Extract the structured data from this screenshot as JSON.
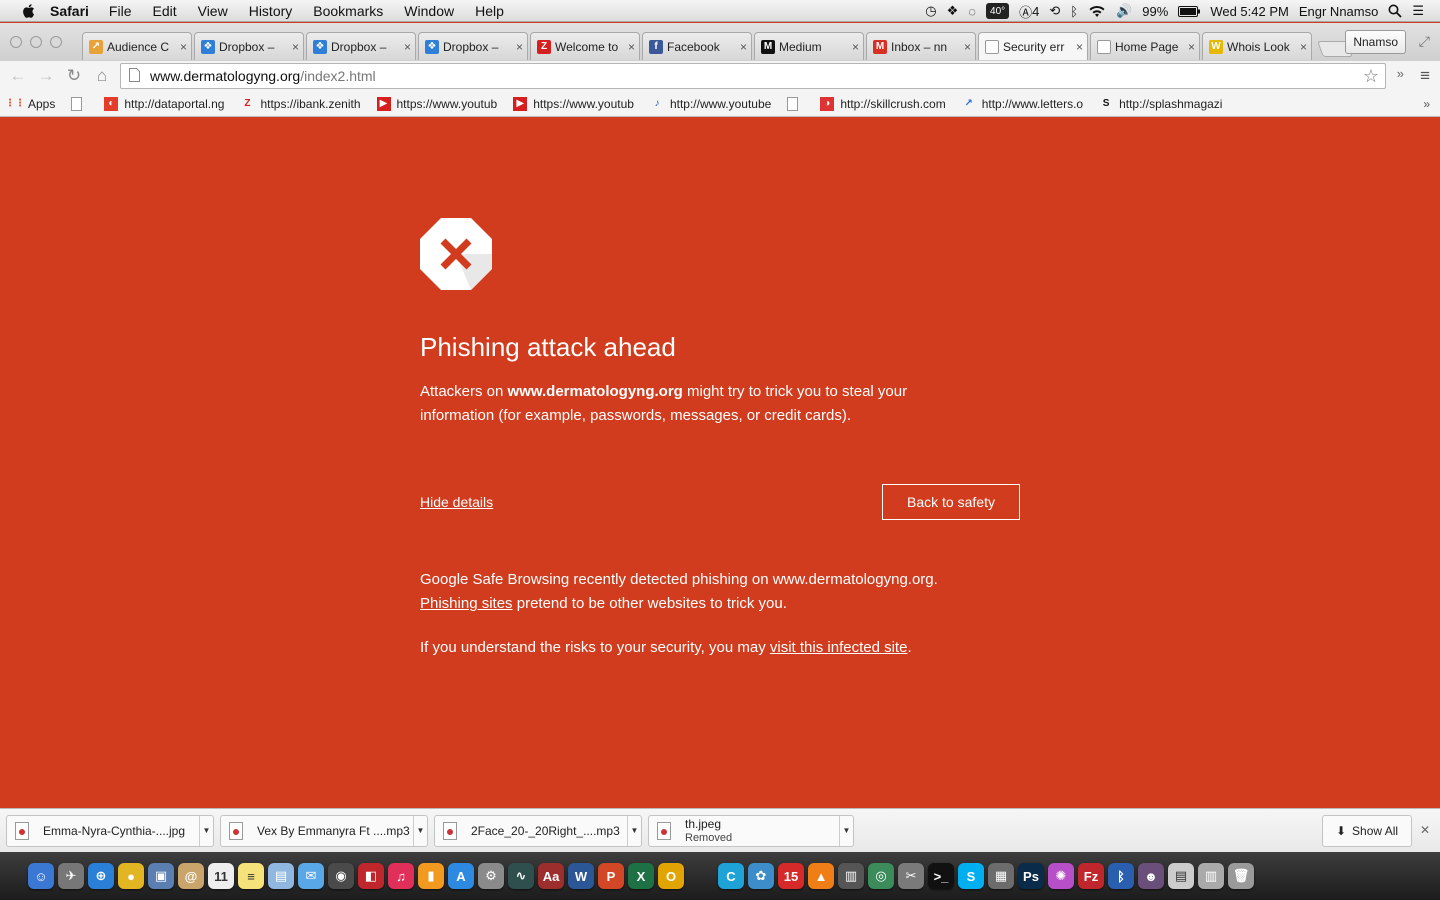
{
  "menubar": {
    "app_name": "Safari",
    "items": [
      "File",
      "Edit",
      "View",
      "History",
      "Bookmarks",
      "Window",
      "Help"
    ],
    "temperature": "40°",
    "adobe_count": "4",
    "battery": "99%",
    "clock": "Wed 5:42 PM",
    "user": "Engr Nnamso"
  },
  "tabs": [
    {
      "title": "Audience C",
      "favicon_color": "#e8a23a",
      "favicon": "chart-icon"
    },
    {
      "title": "Dropbox –",
      "favicon_color": "#2f7ed8",
      "favicon": "dropbox-icon"
    },
    {
      "title": "Dropbox –",
      "favicon_color": "#2f7ed8",
      "favicon": "dropbox-icon"
    },
    {
      "title": "Dropbox –",
      "favicon_color": "#2f7ed8",
      "favicon": "dropbox-icon"
    },
    {
      "title": "Welcome to",
      "favicon_color": "#d6201f",
      "favicon": "zenith-icon"
    },
    {
      "title": "Facebook",
      "favicon_color": "#3b5998",
      "favicon": "facebook-icon"
    },
    {
      "title": "Medium",
      "favicon_color": "#111111",
      "favicon": "medium-icon"
    },
    {
      "title": "Inbox – nn",
      "favicon_color": "#d93025",
      "favicon": "gmail-icon"
    },
    {
      "title": "Security err",
      "favicon_color": "#999999",
      "favicon": "document-icon"
    },
    {
      "title": "Home Page",
      "favicon_color": "#999999",
      "favicon": "document-icon"
    },
    {
      "title": "Whois Look",
      "favicon_color": "#e6b800",
      "favicon": "whois-icon"
    }
  ],
  "profile_button": "Nnamso",
  "address": {
    "host": "www.dermatologyng.org",
    "path": "/index2.html"
  },
  "bookmarks": [
    {
      "label": "Apps",
      "icon": "apps-grid-icon"
    },
    {
      "label": "",
      "icon": "document-icon"
    },
    {
      "label": "http://dataportal.ng",
      "icon": "dataportal-icon"
    },
    {
      "label": "https://ibank.zenith",
      "icon": "zenith-icon"
    },
    {
      "label": "https://www.youtub",
      "icon": "youtube-icon"
    },
    {
      "label": "https://www.youtub",
      "icon": "youtube-icon"
    },
    {
      "label": "http://www.youtube",
      "icon": "mp3-icon"
    },
    {
      "label": "",
      "icon": "document-icon"
    },
    {
      "label": "http://skillcrush.com",
      "icon": "skillcrush-icon"
    },
    {
      "label": "http://www.letters.o",
      "icon": "letters-icon"
    },
    {
      "label": "http://splashmagazi",
      "icon": "splash-icon"
    }
  ],
  "interstitial": {
    "headline": "Phishing attack ahead",
    "lead_prefix": "Attackers on ",
    "lead_domain": "www.dermatologyng.org",
    "lead_suffix": " might try to trick you to steal your information (for example, passwords, messages, or credit cards).",
    "hide_details": "Hide details",
    "back_button": "Back to safety",
    "detail_1": "Google Safe Browsing recently detected phishing on www.dermatologyng.org.",
    "detail_2_link": "Phishing sites",
    "detail_2_rest": " pretend to be other websites to trick you.",
    "detail_3_prefix": "If you understand the risks to your security, you may ",
    "detail_3_link": "visit this infected site",
    "detail_3_suffix": ".",
    "background_color": "#d13c1e"
  },
  "downloads": {
    "items": [
      {
        "name": "Emma-Nyra-Cynthia-....jpg"
      },
      {
        "name": "Vex By Emmanyra Ft ....mp3"
      },
      {
        "name": "2Face_20-_20Right_....mp3"
      },
      {
        "name": "th.jpeg",
        "status": "Removed"
      }
    ],
    "show_all": "Show All"
  },
  "dock": {
    "apps": [
      {
        "name": "finder-icon",
        "color": "#3a78d4",
        "glyph": "☺"
      },
      {
        "name": "launchpad-icon",
        "color": "#777777",
        "glyph": "✈"
      },
      {
        "name": "safari-icon",
        "color": "#2a7fd6",
        "glyph": "⊕"
      },
      {
        "name": "chrome-icon",
        "color": "#e2b523",
        "glyph": "●"
      },
      {
        "name": "preview-icon",
        "color": "#5a7fb0",
        "glyph": "▣"
      },
      {
        "name": "contacts-icon",
        "color": "#c9a46b",
        "glyph": "@"
      },
      {
        "name": "calendar-icon",
        "color": "#eeeeee",
        "glyph": "11"
      },
      {
        "name": "notes-icon",
        "color": "#f5e27a",
        "glyph": "≡"
      },
      {
        "name": "photos-icon",
        "color": "#8fb7df",
        "glyph": "▤"
      },
      {
        "name": "messages-icon",
        "color": "#5aa7e8",
        "glyph": "✉"
      },
      {
        "name": "facetime-icon",
        "color": "#4a4a4a",
        "glyph": "◉"
      },
      {
        "name": "photo-booth-icon",
        "color": "#c0272d",
        "glyph": "◧"
      },
      {
        "name": "itunes-icon",
        "color": "#e0305a",
        "glyph": "♫"
      },
      {
        "name": "ibooks-icon",
        "color": "#f29a1f",
        "glyph": "▮"
      },
      {
        "name": "app-store-icon",
        "color": "#2d8ae0",
        "glyph": "A"
      },
      {
        "name": "system-preferences-icon",
        "color": "#8a8a8a",
        "glyph": "⚙"
      },
      {
        "name": "activity-monitor-icon",
        "color": "#2f4f4f",
        "glyph": "∿"
      },
      {
        "name": "dictionary-icon",
        "color": "#9c2e2e",
        "glyph": "Aa"
      },
      {
        "name": "word-icon",
        "color": "#2b5797",
        "glyph": "W"
      },
      {
        "name": "powerpoint-icon",
        "color": "#d24726",
        "glyph": "P"
      },
      {
        "name": "excel-icon",
        "color": "#1e7145",
        "glyph": "X"
      },
      {
        "name": "outlook-icon",
        "color": "#e2a400",
        "glyph": "O"
      },
      {
        "name": "communicator-icon",
        "color": "#1fa3d6",
        "glyph": "C"
      },
      {
        "name": "messenger-icon",
        "color": "#3c8dc9",
        "glyph": "✿"
      },
      {
        "name": "badge-15-icon",
        "color": "#d62a2a",
        "glyph": "15"
      },
      {
        "name": "vlc-icon",
        "color": "#f07e16",
        "glyph": "▲"
      },
      {
        "name": "console-icon",
        "color": "#555555",
        "glyph": "▥"
      },
      {
        "name": "network-icon",
        "color": "#3c8b5a",
        "glyph": "◎"
      },
      {
        "name": "utilities-icon",
        "color": "#7a7a7a",
        "glyph": "✂"
      },
      {
        "name": "terminal-icon",
        "color": "#111111",
        "glyph": ">_"
      },
      {
        "name": "skype-icon",
        "color": "#00aff0",
        "glyph": "S"
      },
      {
        "name": "image-capture-icon",
        "color": "#6c6c6c",
        "glyph": "▦"
      },
      {
        "name": "photoshop-icon",
        "color": "#0b2b4a",
        "glyph": "Ps"
      },
      {
        "name": "flower-app-icon",
        "color": "#b64fc8",
        "glyph": "✺"
      },
      {
        "name": "filezilla-icon",
        "color": "#c0272d",
        "glyph": "Fz"
      },
      {
        "name": "bluetooth-icon",
        "color": "#2a5fb0",
        "glyph": "ᛒ"
      },
      {
        "name": "user-folder-icon",
        "color": "#6a4f7a",
        "glyph": "☻"
      },
      {
        "name": "documents-stack-icon",
        "color": "#cccccc",
        "glyph": "▤"
      },
      {
        "name": "downloads-stack-icon",
        "color": "#aaaaaa",
        "glyph": "▥"
      },
      {
        "name": "trash-icon",
        "color": "#9a9a9a",
        "glyph": "🗑"
      }
    ]
  }
}
